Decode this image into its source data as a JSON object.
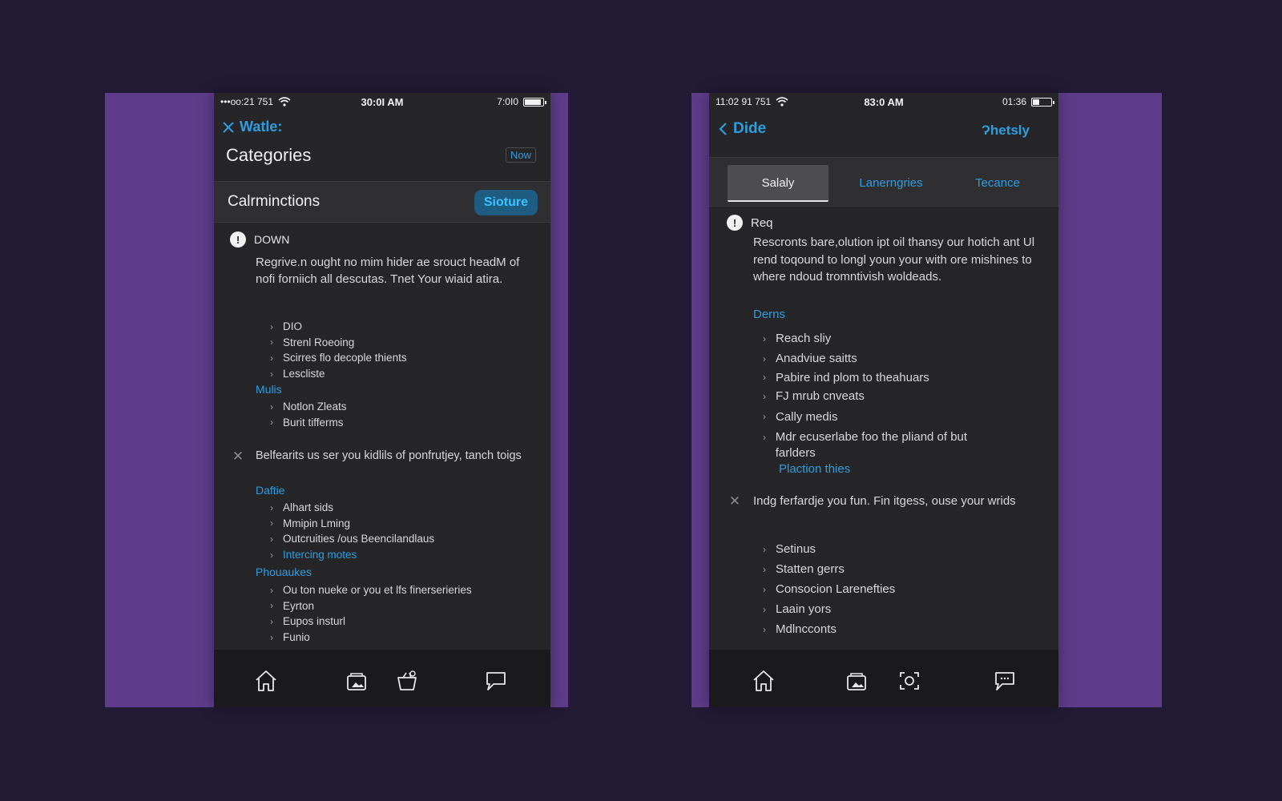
{
  "left_phone": {
    "status": {
      "carrier": "•••oo:21 751",
      "time": "30:0I AM",
      "right": "7:0I0"
    },
    "nav": {
      "back_label": "Watle:",
      "title": "Categories",
      "badge": "Now"
    },
    "section": {
      "title": "Calrminctions",
      "pill": "Sioture"
    },
    "entry1": {
      "title": "DOWN",
      "text": "Regrive.n ought no mim hider ae srouct headM of nofi forniich all descutas. Tnet Your wiaid atira.",
      "bullets": [
        "DIO",
        "Strenl Roeoing",
        "Scirres flo decople thients",
        "Lescliste"
      ],
      "sublabel": "Mulis",
      "bullets2": [
        "Notlon Zleats",
        "Burit tifferms"
      ]
    },
    "entry2": {
      "text": "Belfearits us ser you kidlils of ponfrutjey, tanch toigs",
      "sublabel1": "Daftie",
      "bullets1": [
        "Alhart sids",
        "Mmipin Lming",
        "Outcruities /ous Beencilandlaus",
        "Intercing motes"
      ],
      "sublabel2": "Phouaukes",
      "bullets2": [
        "Ou ton nueke or you et lfs finerserieries",
        "Eyrton",
        "Eupos insturl",
        "Funio"
      ]
    },
    "tabbar": [
      "home-icon",
      "photo-folder-icon",
      "basket-icon",
      "chat-icon"
    ]
  },
  "right_phone": {
    "status": {
      "carrier": "11:02 91 751",
      "time": "83:0 AM",
      "right": "01:36"
    },
    "nav": {
      "back_label": "Dide",
      "action": "Ɂhetsly"
    },
    "tabs": [
      "Salaly",
      "Lanerngries",
      "Tecance"
    ],
    "active_tab": 0,
    "entry1": {
      "title": "Req",
      "text": "Rescronts bare,olution ipt oil thansy our hotich ant Ul rend toqound to longl youn your with ore mishines to where ndoud tromntivish woldeads.",
      "sublabel": "Derns",
      "bullets": [
        "Reach sliy",
        "Anadviue saitts",
        "Pabire ind plom to theahuars",
        "FJ mrub cnveats",
        "Cally medis",
        "Mdr ecuserlabe foo the pliand of but farlders"
      ],
      "link": "Plaction thies"
    },
    "entry2": {
      "text": "Indg ferfardje you fun. Fin itgess, ouse your wrids",
      "bullets": [
        "Setinus",
        "Statten gerrs",
        "Consocion Larenefties",
        "Laain yors",
        "Mdlncconts"
      ]
    },
    "tabbar": [
      "home-icon",
      "photo-folder-icon",
      "scan-icon",
      "chat-icon"
    ]
  }
}
